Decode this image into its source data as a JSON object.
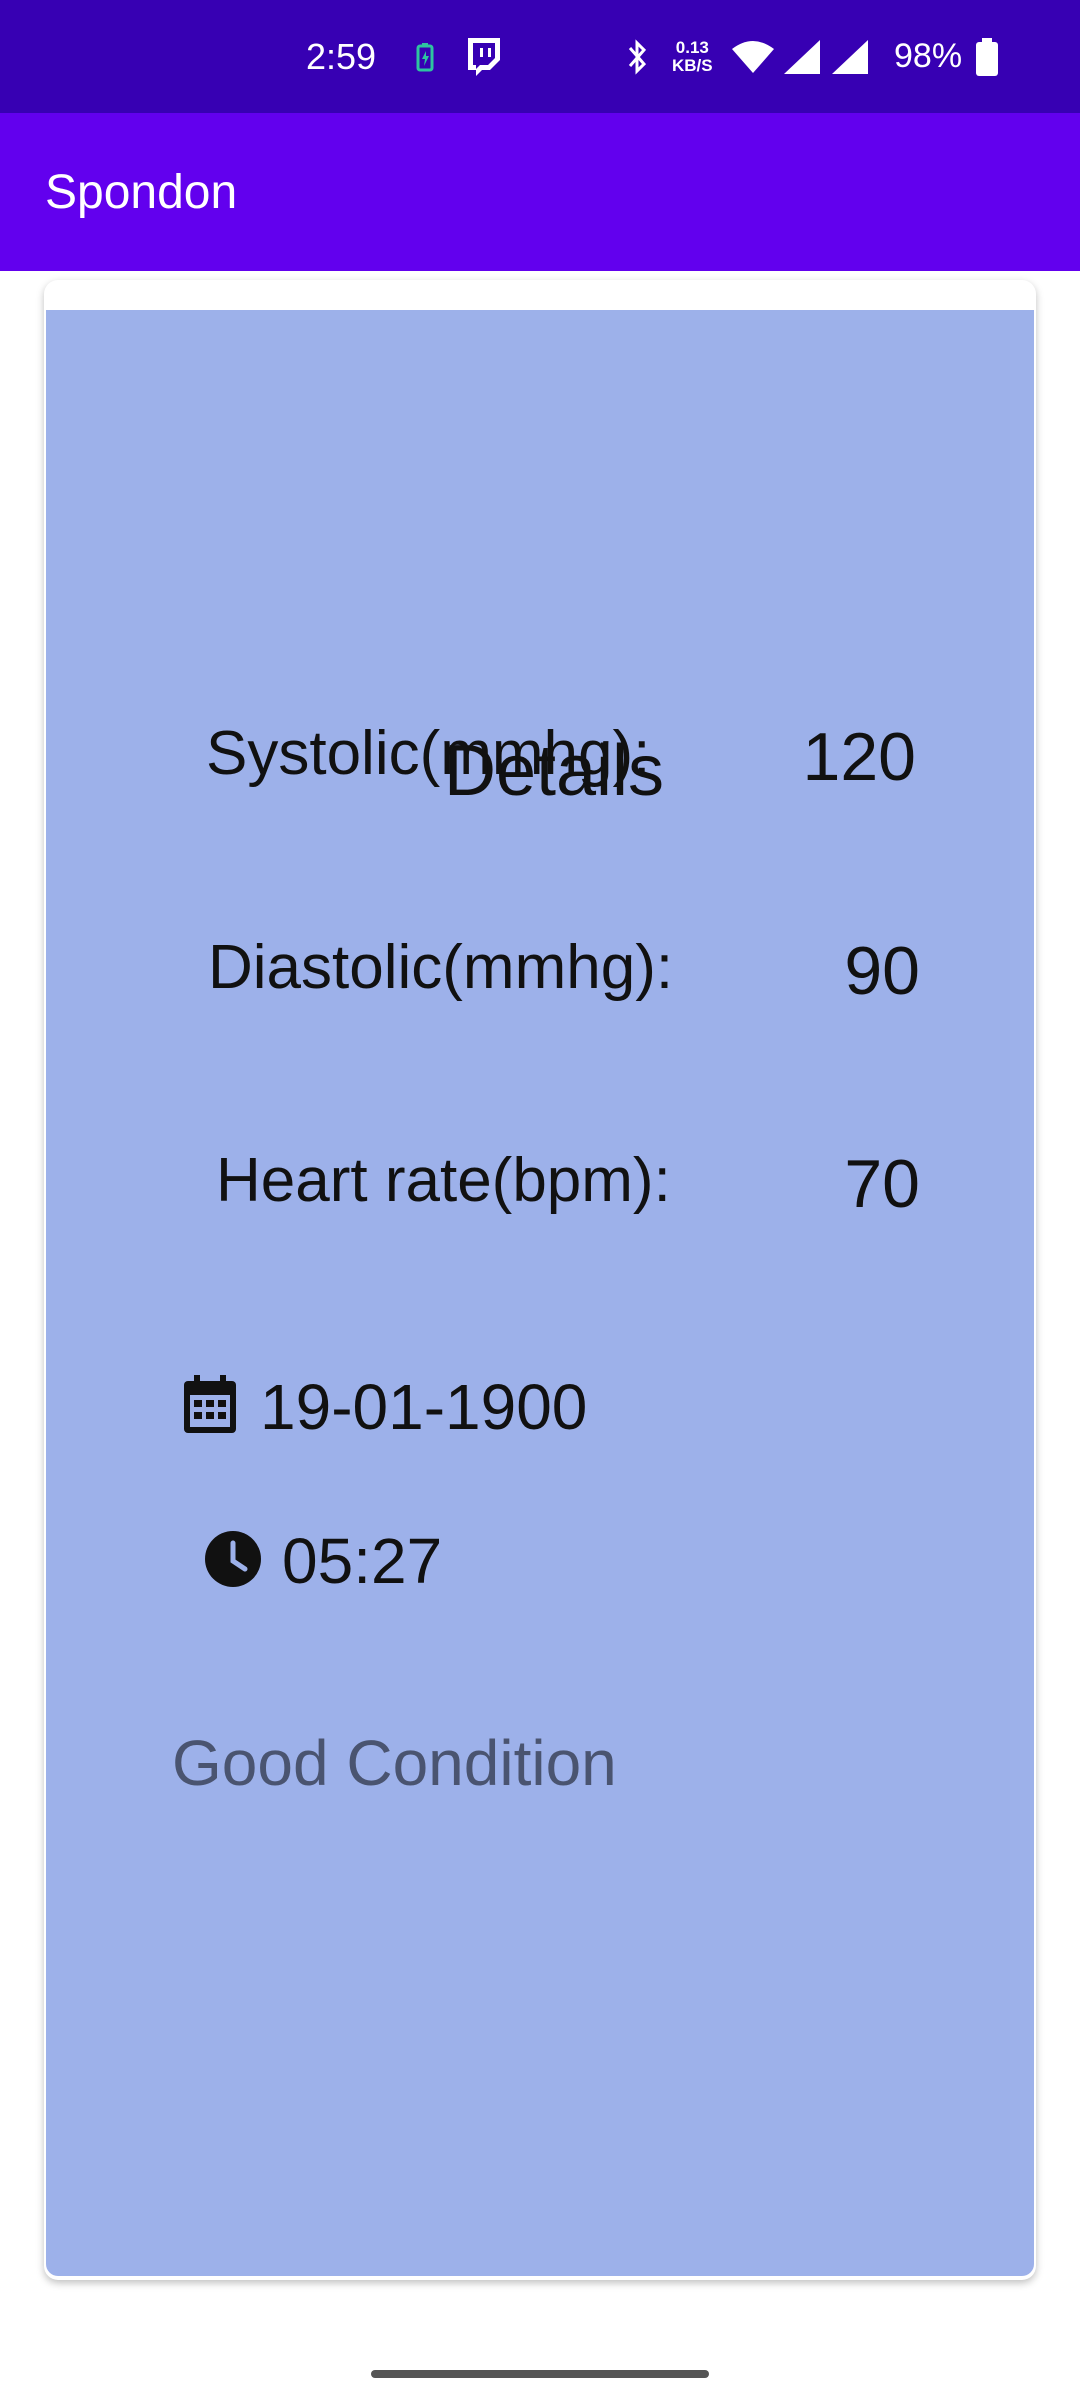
{
  "status_bar": {
    "time": "2:59",
    "net_speed_value": "0.13",
    "net_speed_unit": "KB/S",
    "battery_percent": "98%",
    "icons": [
      "battery-saver-icon",
      "twitch-icon",
      "bluetooth-icon",
      "wifi-icon",
      "signal-icon",
      "signal-icon",
      "battery-icon"
    ]
  },
  "app_bar": {
    "title": "Spondon"
  },
  "details": {
    "title": "Details",
    "systolic_label": "Systolic(mmhg):",
    "systolic_value": "120",
    "diastolic_label": "Diastolic(mmhg):",
    "diastolic_value": "90",
    "heart_rate_label": "Heart rate(bpm):",
    "heart_rate_value": "70",
    "date": "19-01-1900",
    "time": "05:27",
    "condition": "Good Condition"
  },
  "colors": {
    "status_bar": "#3700b3",
    "app_bar": "#6200ee",
    "card": "#9db1ea",
    "condition_text": "#4a5470"
  }
}
